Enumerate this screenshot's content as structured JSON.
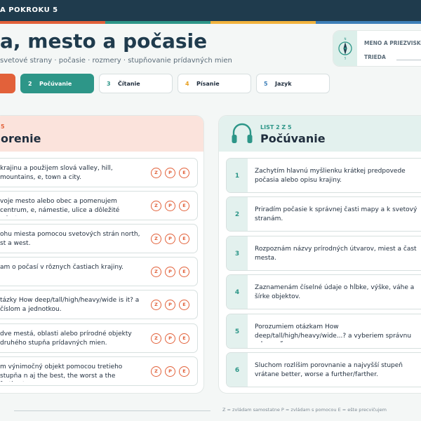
{
  "header": {
    "title": "A POKROKU 5",
    "stripe_colors": [
      "#e2613a",
      "#2d9688",
      "#f2b33d",
      "#3d7fb8"
    ]
  },
  "hero": {
    "title": "a, mesto a počasie",
    "subtitle": "svetové strany · počasie · rozmery · stupňovanie prídavných mien"
  },
  "id_card": {
    "name_label": "MENO A PRIEZVISKO",
    "class_label": "TRIEDA",
    "icon": "compass-icon"
  },
  "tabs": [
    {
      "num": "",
      "label": ""
    },
    {
      "num": "2",
      "label": "Počúvanie"
    },
    {
      "num": "3",
      "label": "Čítanie"
    },
    {
      "num": "4",
      "label": "Písanie"
    },
    {
      "num": "5",
      "label": "Jazyk"
    }
  ],
  "left_panel": {
    "sheet_label": "5",
    "title": "orenie",
    "grade_letters": [
      "Z",
      "P",
      "E"
    ],
    "items": [
      {
        "text": "krajinu a použijem slová valley, hill, mountains, e, town a city."
      },
      {
        "text": "voje mesto alebo obec a pomenujem centrum, e, námestie, ulice a dôležité miesta."
      },
      {
        "text": "ohu miesta pomocou svetových strán north, st a west."
      },
      {
        "text": "am o počasí v rôznych častiach krajiny."
      },
      {
        "text": "tázky How deep/tall/high/heavy/wide is it? a číslom a jednotkou."
      },
      {
        "text": "dve mestá, oblasti alebo prírodné objekty druhého stupňa prídavných mien."
      },
      {
        "text": "m výnimočný objekt pomocou tretieho stupňa n aj the best, the worst a the furthest."
      }
    ]
  },
  "right_panel": {
    "sheet_label": "LIST 2 Z 5",
    "title": "Počúvanie",
    "icon": "headphones-icon",
    "items": [
      {
        "num": "1",
        "text": "Zachytím hlavnú myšlienku krátkej predpovede počasia alebo opisu krajiny."
      },
      {
        "num": "2",
        "text": "Priradím počasie k správnej časti mapy a k svetový stranám."
      },
      {
        "num": "3",
        "text": "Rozpoznám názvy prírodných útvarov, miest a čast mesta."
      },
      {
        "num": "4",
        "text": "Zaznamenám číselné údaje o hĺbke, výške, váhe a šírke objektov."
      },
      {
        "num": "5",
        "text": "Porozumiem otázkam How deep/tall/high/heavy/wide...? a vyberiem správnu odpoveď."
      },
      {
        "num": "6",
        "text": "Sluchom rozlíšim porovnanie a najvyšší stupeň vrátane better, worse a further/farther."
      }
    ]
  },
  "footer": {
    "legend": "Z = zvládam samostatne   P = zvládam s pomocou   E = ešte precvičujem"
  }
}
